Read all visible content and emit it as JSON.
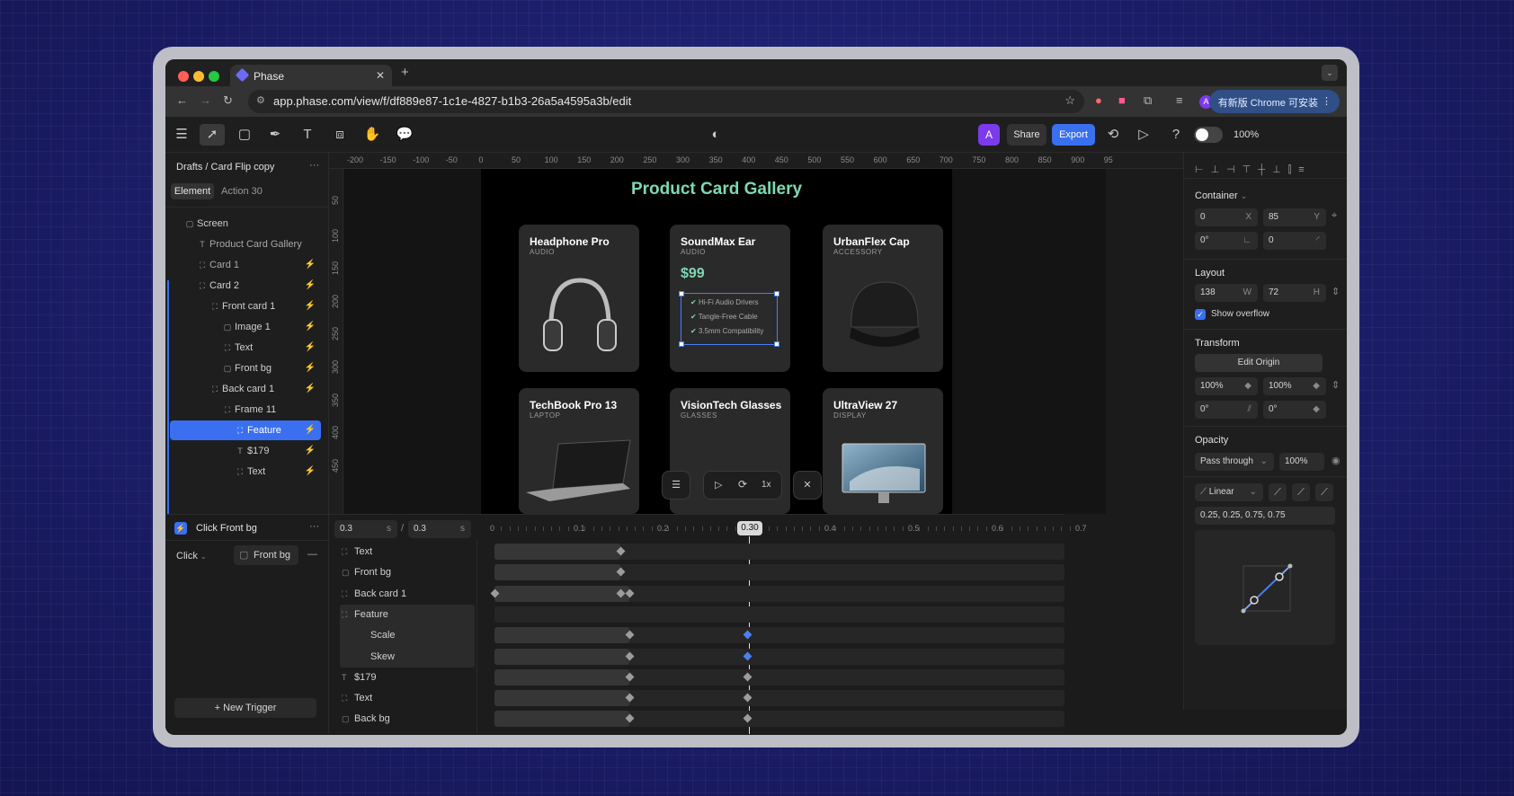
{
  "browser": {
    "tab_title": "Phase",
    "tab_close": "✕",
    "new_tab": "+",
    "url": "app.phase.com/view/f/df889e87-1c1e-4827-b1b3-26a5a4595a3b/edit",
    "update_button": "有新版 Chrome 可安装",
    "profile_initial": "A"
  },
  "toolbar": {
    "avatar": "A",
    "share_label": "Share",
    "export_label": "Export",
    "zoom": "100%"
  },
  "left": {
    "breadcrumb": "Drafts / Card Flip copy",
    "more": "···",
    "tab_element": "Element",
    "tab_action": "Action",
    "action_count": "30",
    "layers": [
      {
        "name": "Screen"
      },
      {
        "name": "Product Card Gallery"
      },
      {
        "name": "Card 1"
      },
      {
        "name": "Card 2"
      },
      {
        "name": "Front card 1"
      },
      {
        "name": "Image 1"
      },
      {
        "name": "Text"
      },
      {
        "name": "Front bg"
      },
      {
        "name": "Back card 1"
      },
      {
        "name": "Frame 11"
      },
      {
        "name": "Feature"
      },
      {
        "name": "$179"
      },
      {
        "name": "Text"
      }
    ]
  },
  "ruler": {
    "h": [
      "-200",
      "-150",
      "-100",
      "-50",
      "0",
      "50",
      "100",
      "150",
      "200",
      "250",
      "300",
      "350",
      "400",
      "450",
      "500",
      "550",
      "600",
      "650",
      "700",
      "750",
      "800",
      "850",
      "900",
      "95"
    ],
    "v": [
      "50",
      "100",
      "150",
      "200",
      "250",
      "300",
      "350",
      "400",
      "450"
    ]
  },
  "canvas": {
    "title": "Product Card Gallery",
    "cards": [
      {
        "name": "Headphone Pro",
        "cat": "AUDIO"
      },
      {
        "name": "SoundMax Ear",
        "cat": "AUDIO",
        "price": "$99",
        "features": [
          "Hi-Fi Audio Drivers",
          "Tangle-Free Cable",
          "3.5mm Compatibility"
        ]
      },
      {
        "name": "UrbanFlex Cap",
        "cat": "ACCESSORY"
      },
      {
        "name": "TechBook Pro 13",
        "cat": "LAPTOP"
      },
      {
        "name": "VisionTech Glasses",
        "cat": "GLASSES"
      },
      {
        "name": "UltraView 27",
        "cat": "DISPLAY"
      }
    ],
    "playback_speed": "1x"
  },
  "right": {
    "container_label": "Container",
    "x": "0",
    "x_unit": "X",
    "y": "85",
    "y_unit": "Y",
    "rotation": "0°",
    "radius": "0",
    "layout_label": "Layout",
    "w": "138",
    "w_unit": "W",
    "h": "72",
    "h_unit": "H",
    "show_overflow": "Show overflow",
    "transform_label": "Transform",
    "edit_origin": "Edit Origin",
    "scale_x": "100%",
    "scale_y": "100%",
    "skew_x": "0°",
    "skew_y": "0°",
    "opacity_label": "Opacity",
    "blend": "Pass through",
    "opacity": "100%",
    "easing": "Linear",
    "bezier": "0.25, 0.25, 0.75, 0.75"
  },
  "timeline": {
    "trigger": "Click Front bg",
    "event": "Click",
    "target": "Front bg",
    "start": "0.3",
    "start_unit": "s",
    "duration": "0.3",
    "duration_unit": "s",
    "current": "0.30",
    "ticks": [
      "0",
      "0.1",
      "0.2",
      "0.4",
      "0.5",
      "0.6",
      "0.7"
    ],
    "new_trigger": "+ New Trigger",
    "tracks": [
      {
        "name": "Text"
      },
      {
        "name": "Front bg"
      },
      {
        "name": "Back card 1"
      },
      {
        "name": "Feature"
      },
      {
        "name": "Scale"
      },
      {
        "name": "Skew"
      },
      {
        "name": "$179"
      },
      {
        "name": "Text"
      },
      {
        "name": "Back bg"
      }
    ]
  },
  "colors": {
    "accent": "#3a6ff0",
    "title_green": "#7dd8b4"
  }
}
